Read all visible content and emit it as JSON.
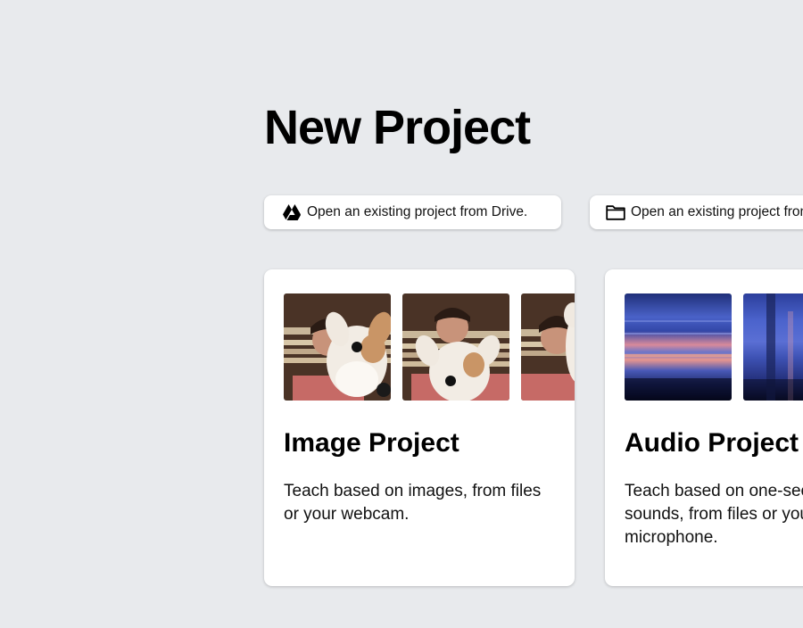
{
  "header": {
    "title": "New Project"
  },
  "actions": {
    "drive_label": "Open an existing project from Drive.",
    "file_label": "Open an existing project from a file."
  },
  "cards": {
    "image": {
      "title": "Image Project",
      "description": "Teach based on images, from files or your webcam."
    },
    "audio": {
      "title": "Audio Project",
      "description": "Teach based on one-second sounds, from files or your microphone."
    }
  },
  "icons": {
    "drive": "google-drive-icon",
    "folder": "folder-icon"
  },
  "colors": {
    "background": "#e8eaed",
    "card": "#ffffff",
    "text": "#000000"
  }
}
